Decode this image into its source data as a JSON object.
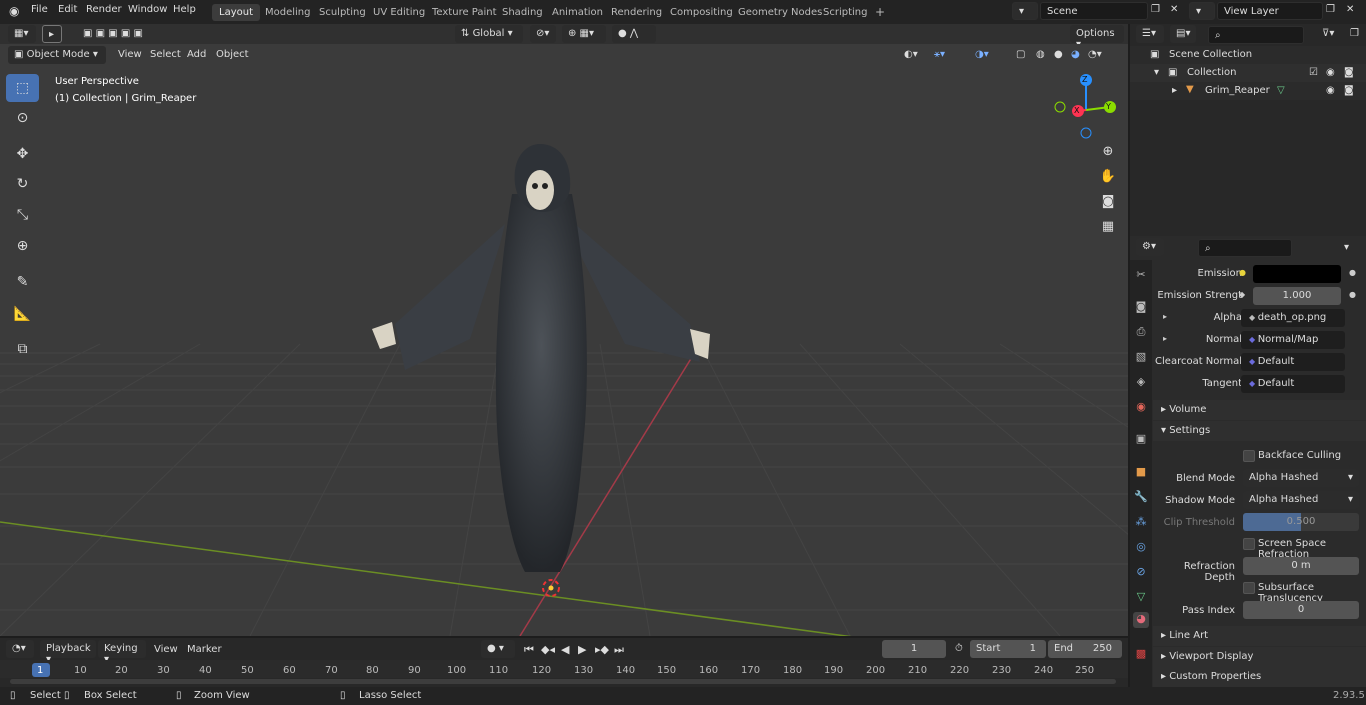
{
  "menu": {
    "file": "File",
    "edit": "Edit",
    "render": "Render",
    "window": "Window",
    "help": "Help"
  },
  "workspaces": [
    "Layout",
    "Modeling",
    "Sculpting",
    "UV Editing",
    "Texture Paint",
    "Shading",
    "Animation",
    "Rendering",
    "Compositing",
    "Geometry Nodes",
    "Scripting"
  ],
  "scene": {
    "name": "Scene",
    "view_layer": "View Layer"
  },
  "viewport_toolbar": {
    "transform_orientation": "Global",
    "options": "Options"
  },
  "viewport_header": {
    "mode": "Object Mode",
    "view": "View",
    "select": "Select",
    "add": "Add",
    "object": "Object"
  },
  "overlay": {
    "perspective": "User Perspective",
    "collection": "(1) Collection | Grim_Reaper"
  },
  "gizmo": {
    "x": "X",
    "y": "Y",
    "z": "Z"
  },
  "outliner": {
    "scene_collection": "Scene Collection",
    "collection": "Collection",
    "object": "Grim_Reaper"
  },
  "properties": {
    "emission_label": "Emission",
    "emission_color": "#000000",
    "emission_strength_label": "Emission Strengt",
    "emission_strength_value": "1.000",
    "alpha_label": "Alpha",
    "alpha_value": "death_op.png",
    "normal_label": "Normal",
    "normal_value": "Normal/Map",
    "clearcoat_normal_label": "Clearcoat Normal",
    "clearcoat_normal_value": "Default",
    "tangent_label": "Tangent",
    "tangent_value": "Default",
    "volume_section": "Volume",
    "settings_section": "Settings",
    "backface_culling": "Backface Culling",
    "blend_mode_label": "Blend Mode",
    "blend_mode_value": "Alpha Hashed",
    "shadow_mode_label": "Shadow Mode",
    "shadow_mode_value": "Alpha Hashed",
    "clip_threshold_label": "Clip Threshold",
    "clip_threshold_value": "0.500",
    "screen_space_refraction": "Screen Space Refraction",
    "refraction_depth_label": "Refraction Depth",
    "refraction_depth_value": "0 m",
    "subsurface_translucency": "Subsurface Translucency",
    "pass_index_label": "Pass Index",
    "pass_index_value": "0",
    "line_art_section": "Line Art",
    "viewport_display_section": "Viewport Display",
    "custom_properties_section": "Custom Properties"
  },
  "timeline": {
    "playback": "Playback",
    "keying": "Keying",
    "view": "View",
    "marker": "Marker",
    "current_frame": "1",
    "start_label": "Start",
    "start_value": "1",
    "end_label": "End",
    "end_value": "250",
    "ticks": [
      "1",
      "10",
      "20",
      "30",
      "40",
      "50",
      "60",
      "70",
      "80",
      "90",
      "100",
      "110",
      "120",
      "130",
      "140",
      "150",
      "160",
      "170",
      "180",
      "190",
      "200",
      "210",
      "220",
      "230",
      "240",
      "250"
    ]
  },
  "statusbar": {
    "select": "Select",
    "box_select": "Box Select",
    "zoom_view": "Zoom View",
    "lasso_select": "Lasso Select",
    "version": "2.93.5"
  },
  "colors": {
    "accent": "#4772b3",
    "x_axis": "#ff3352",
    "y_axis": "#8bdc00",
    "z_axis": "#2890ff",
    "viewport_bg": "#3b3b3b"
  }
}
